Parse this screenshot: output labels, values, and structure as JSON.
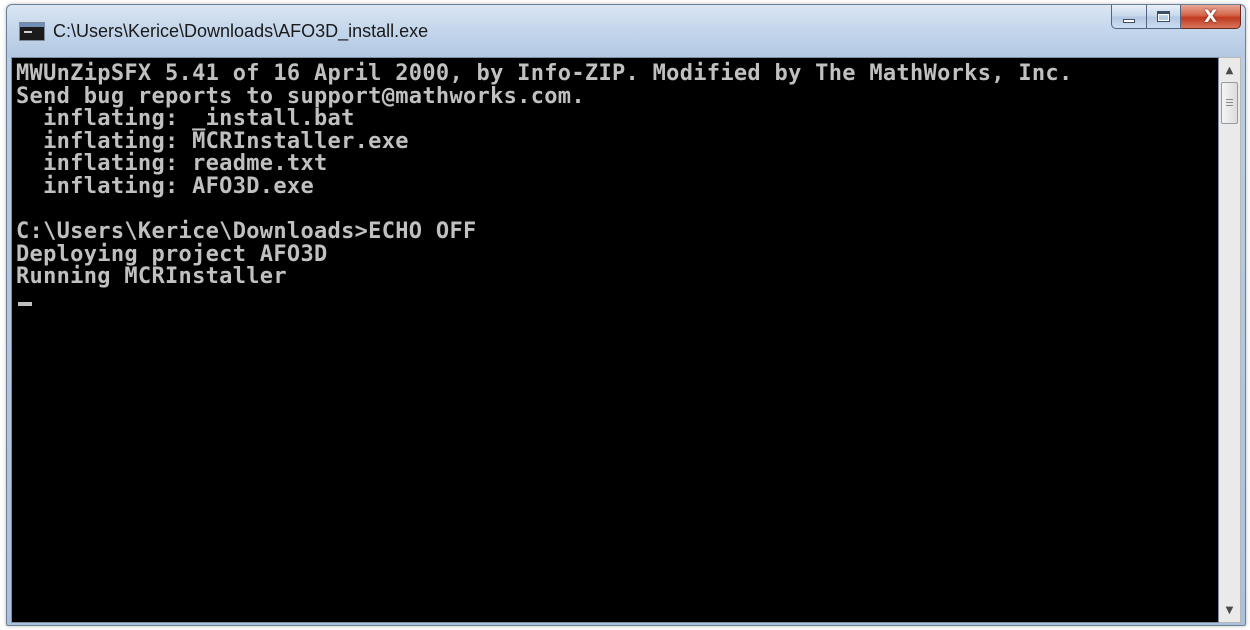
{
  "window": {
    "title": "C:\\Users\\Kerice\\Downloads\\AFO3D_install.exe",
    "controls": {
      "minimize_icon": "minimize-icon",
      "maximize_icon": "maximize-icon",
      "close_icon": "close-icon",
      "close_glyph": "X"
    }
  },
  "console": {
    "lines": [
      "MWUnZipSFX 5.41 of 16 April 2000, by Info-ZIP. Modified by The MathWorks, Inc.",
      "Send bug reports to support@mathworks.com.",
      "  inflating: _install.bat",
      "  inflating: MCRInstaller.exe",
      "  inflating: readme.txt",
      "  inflating: AFO3D.exe",
      "",
      "C:\\Users\\Kerice\\Downloads>ECHO OFF",
      "Deploying project AFO3D",
      "Running MCRInstaller"
    ],
    "foreground": "#c0c0c0",
    "background": "#000000"
  },
  "scrollbar": {
    "up_arrow": "▲",
    "down_arrow": "▼"
  }
}
